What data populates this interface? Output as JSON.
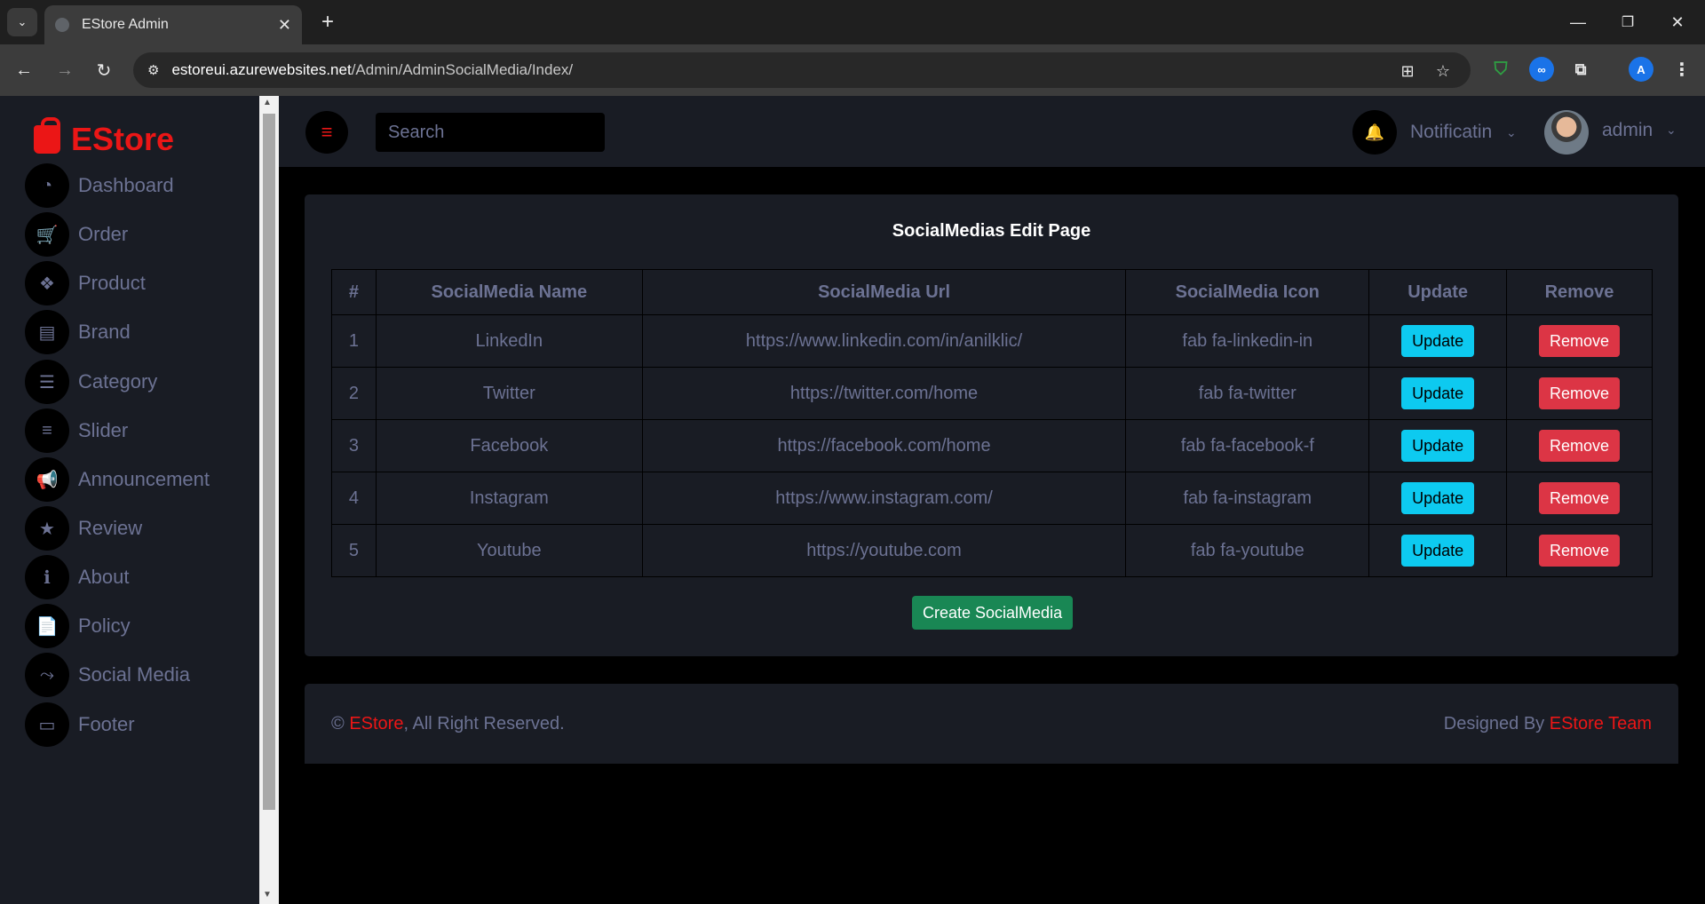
{
  "browser": {
    "tab_title": "EStore Admin",
    "url_host": "estoreui.azurewebsites.net",
    "url_path": "/Admin/AdminSocialMedia/Index/",
    "profile_initial": "A"
  },
  "brand": {
    "name": "EStore",
    "color": "#eb1616"
  },
  "sidebar": {
    "items": [
      {
        "label": "Dashboard",
        "icon": "tachometer-icon",
        "glyph": "◔"
      },
      {
        "label": "Order",
        "icon": "cart-icon",
        "glyph": "🛒"
      },
      {
        "label": "Product",
        "icon": "cubes-icon",
        "glyph": "❖"
      },
      {
        "label": "Brand",
        "icon": "book-icon",
        "glyph": "▤"
      },
      {
        "label": "Category",
        "icon": "list-alt-icon",
        "glyph": "☰"
      },
      {
        "label": "Slider",
        "icon": "sliders-icon",
        "glyph": "≡"
      },
      {
        "label": "Announcement",
        "icon": "bullhorn-icon",
        "glyph": "📢"
      },
      {
        "label": "Review",
        "icon": "star-icon",
        "glyph": "★"
      },
      {
        "label": "About",
        "icon": "info-icon",
        "glyph": "ℹ"
      },
      {
        "label": "Policy",
        "icon": "file-icon",
        "glyph": "📄"
      },
      {
        "label": "Social Media",
        "icon": "share-icon",
        "glyph": "⤳"
      },
      {
        "label": "Footer",
        "icon": "id-card-icon",
        "glyph": "▭"
      }
    ]
  },
  "topnav": {
    "search_placeholder": "Search",
    "notification_label": "Notificatin",
    "user_label": "admin"
  },
  "main": {
    "title": "SocialMedias Edit Page",
    "columns": [
      "#",
      "SocialMedia Name",
      "SocialMedia Url",
      "SocialMedia Icon",
      "Update",
      "Remove"
    ],
    "rows": [
      {
        "num": "1",
        "name": "LinkedIn",
        "url": "https://www.linkedin.com/in/anilklic/",
        "icon": "fab fa-linkedin-in"
      },
      {
        "num": "2",
        "name": "Twitter",
        "url": "https://twitter.com/home",
        "icon": "fab fa-twitter"
      },
      {
        "num": "3",
        "name": "Facebook",
        "url": "https://facebook.com/home",
        "icon": "fab fa-facebook-f"
      },
      {
        "num": "4",
        "name": "Instagram",
        "url": "https://www.instagram.com/",
        "icon": "fab fa-instagram"
      },
      {
        "num": "5",
        "name": "Youtube",
        "url": "https://youtube.com",
        "icon": "fab fa-youtube"
      }
    ],
    "update_label": "Update",
    "remove_label": "Remove",
    "create_label": "Create SocialMedia"
  },
  "footer": {
    "copyright_symbol": "©",
    "brand": "EStore",
    "rights": ", All Right Reserved.",
    "designed_by": "Designed By",
    "team": "EStore Team"
  },
  "colors": {
    "sidebar_bg": "#191c24",
    "text_muted": "#6c7293",
    "accent_red": "#eb1616",
    "update_btn": "#0dcaf0",
    "remove_btn": "#dc3545",
    "create_btn": "#198754"
  }
}
